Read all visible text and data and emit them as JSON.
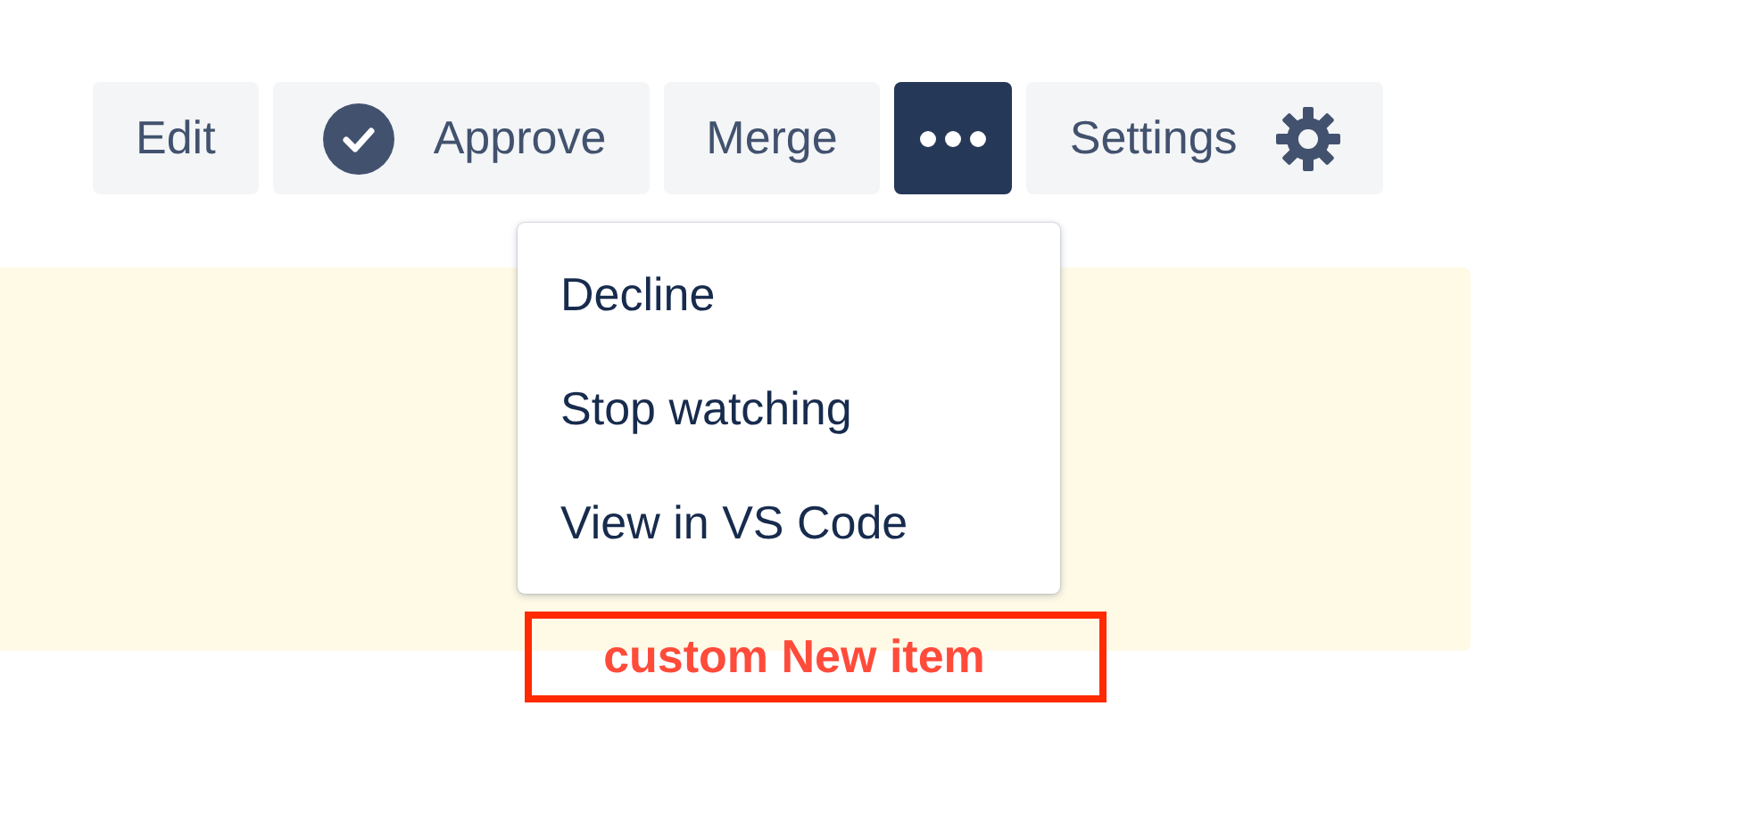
{
  "toolbar": {
    "buttons": [
      {
        "label": "Edit",
        "kind": "text",
        "selected": false
      },
      {
        "label": "Approve",
        "kind": "check",
        "selected": false
      },
      {
        "label": "Merge",
        "kind": "text",
        "selected": false
      },
      {
        "kind": "more",
        "selected": true
      },
      {
        "label": "Settings",
        "kind": "gear",
        "selected": false
      }
    ]
  },
  "dropdown_menu": {
    "items": [
      "Decline",
      "Stop watching",
      "View in VS Code"
    ]
  },
  "annotation": {
    "text": "custom New item"
  }
}
